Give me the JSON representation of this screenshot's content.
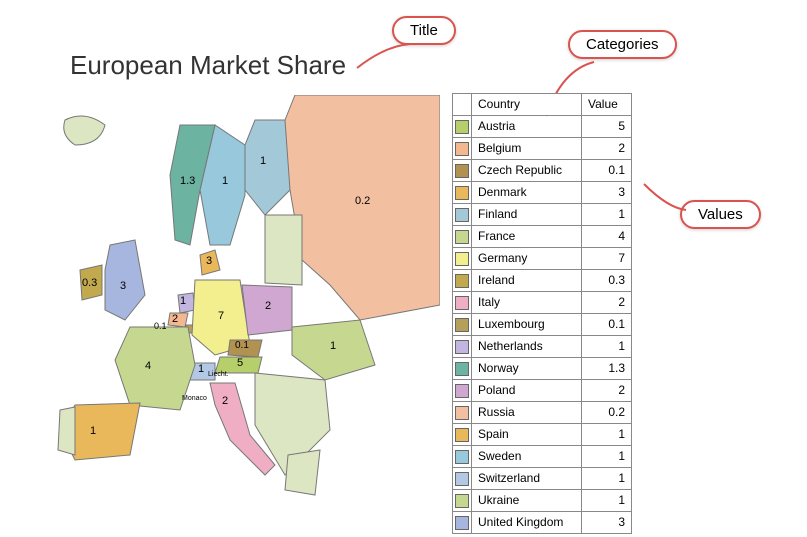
{
  "title": "European Market Share",
  "callouts": {
    "title": "Title",
    "categories": "Categories",
    "values": "Values"
  },
  "table": {
    "header_swatch": "",
    "header_country": "Country",
    "header_value": "Value"
  },
  "micro_labels": {
    "liecht": "Liecht.",
    "monaco": "Monaco"
  },
  "chart_data": {
    "type": "choropleth-map",
    "title": "European Market Share",
    "region": "Europe",
    "entries": [
      {
        "country": "Austria",
        "value": 5,
        "color": "#b6cf6b"
      },
      {
        "country": "Belgium",
        "value": 2,
        "color": "#f3b890"
      },
      {
        "country": "Czech Republic",
        "value": 0.1,
        "color": "#b19251"
      },
      {
        "country": "Denmark",
        "value": 3,
        "color": "#e9b85b"
      },
      {
        "country": "Finland",
        "value": 1,
        "color": "#a3c8d8"
      },
      {
        "country": "France",
        "value": 4,
        "color": "#c6d88f"
      },
      {
        "country": "Germany",
        "value": 7,
        "color": "#f3ef8f"
      },
      {
        "country": "Ireland",
        "value": 0.3,
        "color": "#c3a94e"
      },
      {
        "country": "Italy",
        "value": 2,
        "color": "#efaec4"
      },
      {
        "country": "Luxembourg",
        "value": 0.1,
        "color": "#b5a05a"
      },
      {
        "country": "Netherlands",
        "value": 1,
        "color": "#c2b6e1"
      },
      {
        "country": "Norway",
        "value": 1.3,
        "color": "#6cb3a2"
      },
      {
        "country": "Poland",
        "value": 2,
        "color": "#cfa7d0"
      },
      {
        "country": "Russia",
        "value": 0.2,
        "color": "#f2c0a1"
      },
      {
        "country": "Spain",
        "value": 1,
        "color": "#e9b85b"
      },
      {
        "country": "Sweden",
        "value": 1,
        "color": "#97c8db"
      },
      {
        "country": "Switzerland",
        "value": 1,
        "color": "#b2c8e5"
      },
      {
        "country": "Ukraine",
        "value": 1,
        "color": "#c6d88f"
      },
      {
        "country": "United Kingdom",
        "value": 3,
        "color": "#a7b6de"
      }
    ],
    "labeled_values_on_map": [
      {
        "country": "Russia",
        "text": "0.2"
      },
      {
        "country": "Finland",
        "text": "1"
      },
      {
        "country": "Sweden",
        "text": "1"
      },
      {
        "country": "Norway",
        "text": "1.3"
      },
      {
        "country": "Ireland",
        "text": "0.3"
      },
      {
        "country": "United Kingdom",
        "text": "3"
      },
      {
        "country": "Denmark",
        "text": "3"
      },
      {
        "country": "Netherlands",
        "text": "1"
      },
      {
        "country": "Belgium",
        "text": "2"
      },
      {
        "country": "Luxembourg",
        "text": "0.1"
      },
      {
        "country": "Germany",
        "text": "7"
      },
      {
        "country": "Poland",
        "text": "2"
      },
      {
        "country": "Czech Republic",
        "text": "0.1"
      },
      {
        "country": "Austria",
        "text": "5"
      },
      {
        "country": "Switzerland",
        "text": "1"
      },
      {
        "country": "France",
        "text": "4"
      },
      {
        "country": "Spain",
        "text": "1"
      },
      {
        "country": "Italy",
        "text": "2"
      },
      {
        "country": "Ukraine",
        "text": "1"
      }
    ]
  }
}
